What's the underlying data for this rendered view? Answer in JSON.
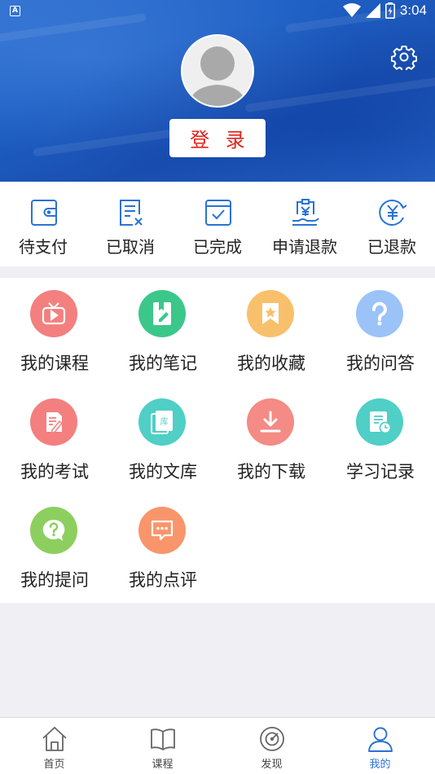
{
  "status_bar": {
    "time": "3:04",
    "notification_icon": "A"
  },
  "profile": {
    "login_label": "登 录"
  },
  "orders": [
    {
      "label": "待支付",
      "icon": "wallet-icon"
    },
    {
      "label": "已取消",
      "icon": "cancelled-doc-icon"
    },
    {
      "label": "已完成",
      "icon": "check-box-icon"
    },
    {
      "label": "申请退款",
      "icon": "refund-request-icon"
    },
    {
      "label": "已退款",
      "icon": "refunded-icon"
    }
  ],
  "menu": [
    {
      "label": "我的课程",
      "icon": "tv-play-icon",
      "color": "#f47f7f"
    },
    {
      "label": "我的笔记",
      "icon": "notebook-icon",
      "color": "#3cc78a"
    },
    {
      "label": "我的收藏",
      "icon": "bookmark-star-icon",
      "color": "#f9c06b"
    },
    {
      "label": "我的问答",
      "icon": "question-icon",
      "color": "#9bc3f8"
    },
    {
      "label": "我的考试",
      "icon": "exam-icon",
      "color": "#f47f7f"
    },
    {
      "label": "我的文库",
      "icon": "library-icon",
      "color": "#4fcfc6"
    },
    {
      "label": "我的下载",
      "icon": "download-icon",
      "color": "#f48b84"
    },
    {
      "label": "学习记录",
      "icon": "study-record-icon",
      "color": "#4fcfc6"
    },
    {
      "label": "我的提问",
      "icon": "ask-question-icon",
      "color": "#8dcf5e"
    },
    {
      "label": "我的点评",
      "icon": "comment-icon",
      "color": "#f9956b"
    }
  ],
  "tabs": [
    {
      "label": "首页",
      "icon": "home-icon"
    },
    {
      "label": "课程",
      "icon": "book-icon"
    },
    {
      "label": "发现",
      "icon": "discover-icon"
    },
    {
      "label": "我的",
      "icon": "profile-icon",
      "active": true
    }
  ],
  "colors": {
    "header_blue": "#1e5fc4",
    "login_red": "#e2231a",
    "active_tab": "#2a72d6",
    "order_icon": "#2a72d6"
  }
}
